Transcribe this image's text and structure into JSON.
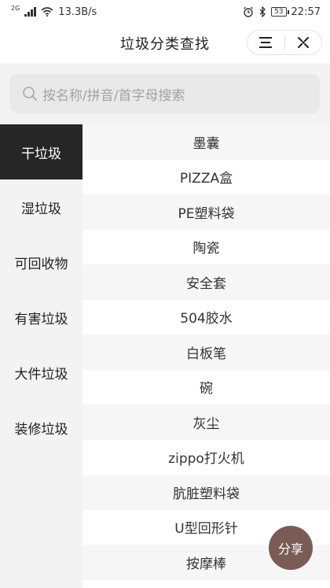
{
  "status_bar": {
    "network_label": "2G",
    "speed": "13.3B/s",
    "battery": "53",
    "time": "22:57"
  },
  "navbar": {
    "title": "垃圾分类查找"
  },
  "search": {
    "placeholder": "按名称/拼音/首字母搜索"
  },
  "sidebar": {
    "items": [
      {
        "label": "干垃圾",
        "active": true
      },
      {
        "label": "湿垃圾",
        "active": false
      },
      {
        "label": "可回收物",
        "active": false
      },
      {
        "label": "有害垃圾",
        "active": false
      },
      {
        "label": "大件垃圾",
        "active": false
      },
      {
        "label": "装修垃圾",
        "active": false
      }
    ]
  },
  "list": {
    "items": [
      "墨囊",
      "PIZZA盒",
      "PE塑料袋",
      "陶瓷",
      "安全套",
      "504胶水",
      "白板笔",
      "碗",
      "灰尘",
      "zippo打火机",
      "肮脏塑料袋",
      "U型回形针",
      "按摩棒"
    ]
  },
  "fab": {
    "label": "分享",
    "color": "#7a5b55"
  },
  "colors": {
    "active_tab": "#262626",
    "sidebar_bg": "#f3f3f3"
  }
}
